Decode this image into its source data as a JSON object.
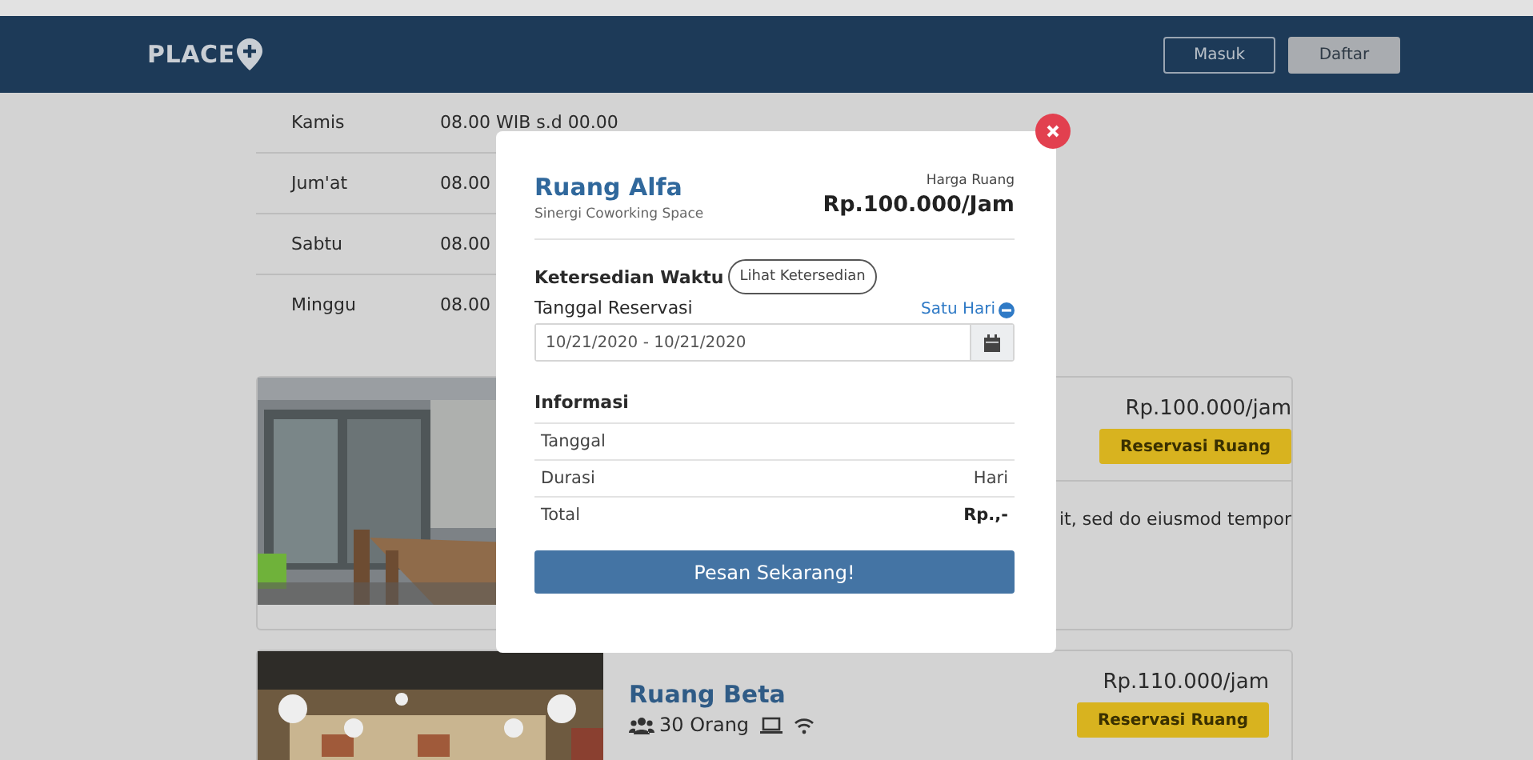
{
  "navbar": {
    "logo": "PLACE",
    "buttons": [
      {
        "label": "Masuk",
        "kind": "outline"
      },
      {
        "label": "Daftar",
        "kind": "filled"
      }
    ]
  },
  "schedule": [
    {
      "day": "Kamis",
      "hours": "08.00 WIB s.d 00.00"
    },
    {
      "day": "Jum'at",
      "hours": "08.00"
    },
    {
      "day": "Sabtu",
      "hours": "08.00"
    },
    {
      "day": "Minggu",
      "hours": "08.00"
    }
  ],
  "rooms": [
    {
      "price": "Rp.100.000/jam",
      "button": "Reservasi Ruang",
      "description": "it, sed do eiusmod tempor"
    },
    {
      "name": "Ruang Beta",
      "capacity": "30 Orang",
      "price": "Rp.110.000/jam",
      "button": "Reservasi Ruang"
    }
  ],
  "modal": {
    "title": "Ruang Alfa",
    "subtitle": "Sinergi Coworking Space",
    "price_label": "Harga Ruang",
    "price": "Rp.100.000/Jam",
    "availability_label": "Ketersedian Waktu",
    "availability_button": "Lihat Ketersedian",
    "date_label": "Tanggal Reservasi",
    "date_toggle": "Satu Hari",
    "date_value": "10/21/2020 - 10/21/2020",
    "info_title": "Informasi",
    "info_rows": [
      {
        "label": "Tanggal",
        "kind": "plain"
      },
      {
        "label": "Durasi",
        "value": "Hari",
        "kind": "plain"
      },
      {
        "label": "Total",
        "value": "Rp.,-",
        "kind": "total"
      }
    ],
    "submit": "Pesan Sekarang!"
  }
}
